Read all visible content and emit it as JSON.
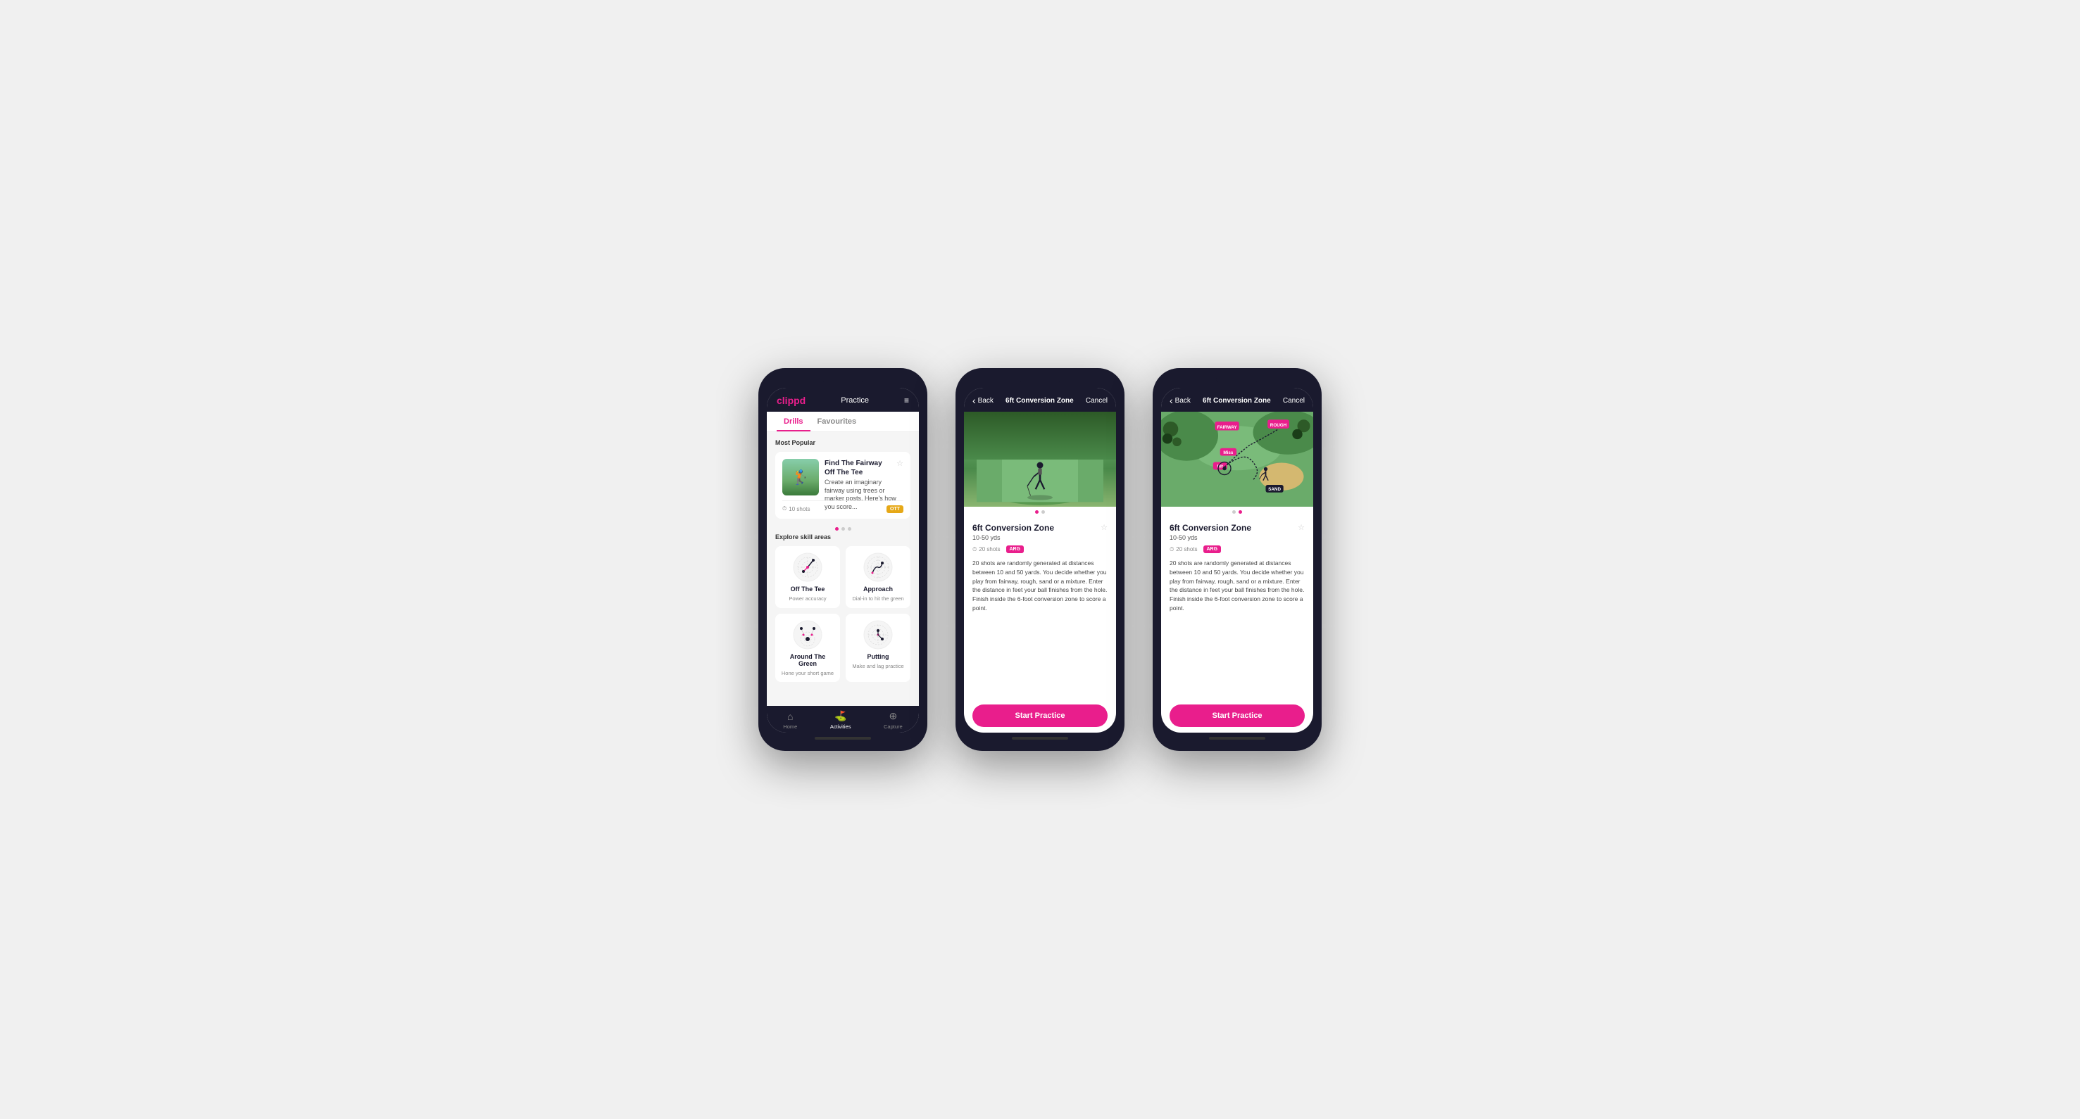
{
  "phone1": {
    "logo": "clippd",
    "header_title": "Practice",
    "menu_icon": "≡",
    "tabs": [
      {
        "label": "Drills",
        "active": true
      },
      {
        "label": "Favourites",
        "active": false
      }
    ],
    "most_popular_label": "Most Popular",
    "featured_drill": {
      "title": "Find The Fairway",
      "subtitle": "Off The Tee",
      "description": "Create an imaginary fairway using trees or marker posts. Here's how you score...",
      "shots": "10 shots",
      "tag": "OTT"
    },
    "explore_label": "Explore skill areas",
    "skills": [
      {
        "name": "Off The Tee",
        "desc": "Power accuracy"
      },
      {
        "name": "Approach",
        "desc": "Dial-in to hit the green"
      },
      {
        "name": "Around The Green",
        "desc": "Hone your short game"
      },
      {
        "name": "Putting",
        "desc": "Make and lag practice"
      }
    ],
    "nav_items": [
      {
        "label": "Home",
        "icon": "⌂",
        "active": false
      },
      {
        "label": "Activities",
        "icon": "⛳",
        "active": true
      },
      {
        "label": "Capture",
        "icon": "⊕",
        "active": false
      }
    ]
  },
  "phone2": {
    "header_back": "Back",
    "header_title": "6ft Conversion Zone",
    "header_cancel": "Cancel",
    "image_type": "photo",
    "drill_title": "6ft Conversion Zone",
    "drill_range": "10-50 yds",
    "shots": "20 shots",
    "tag": "ARG",
    "description": "20 shots are randomly generated at distances between 10 and 50 yards. You decide whether you play from fairway, rough, sand or a mixture. Enter the distance in feet your ball finishes from the hole. Finish inside the 6-foot conversion zone to score a point.",
    "start_btn": "Start Practice"
  },
  "phone3": {
    "header_back": "Back",
    "header_title": "6ft Conversion Zone",
    "header_cancel": "Cancel",
    "image_type": "map",
    "drill_title": "6ft Conversion Zone",
    "drill_range": "10-50 yds",
    "shots": "20 shots",
    "tag": "ARG",
    "description": "20 shots are randomly generated at distances between 10 and 50 yards. You decide whether you play from fairway, rough, sand or a mixture. Enter the distance in feet your ball finishes from the hole. Finish inside the 6-foot conversion zone to score a point.",
    "start_btn": "Start Practice"
  }
}
